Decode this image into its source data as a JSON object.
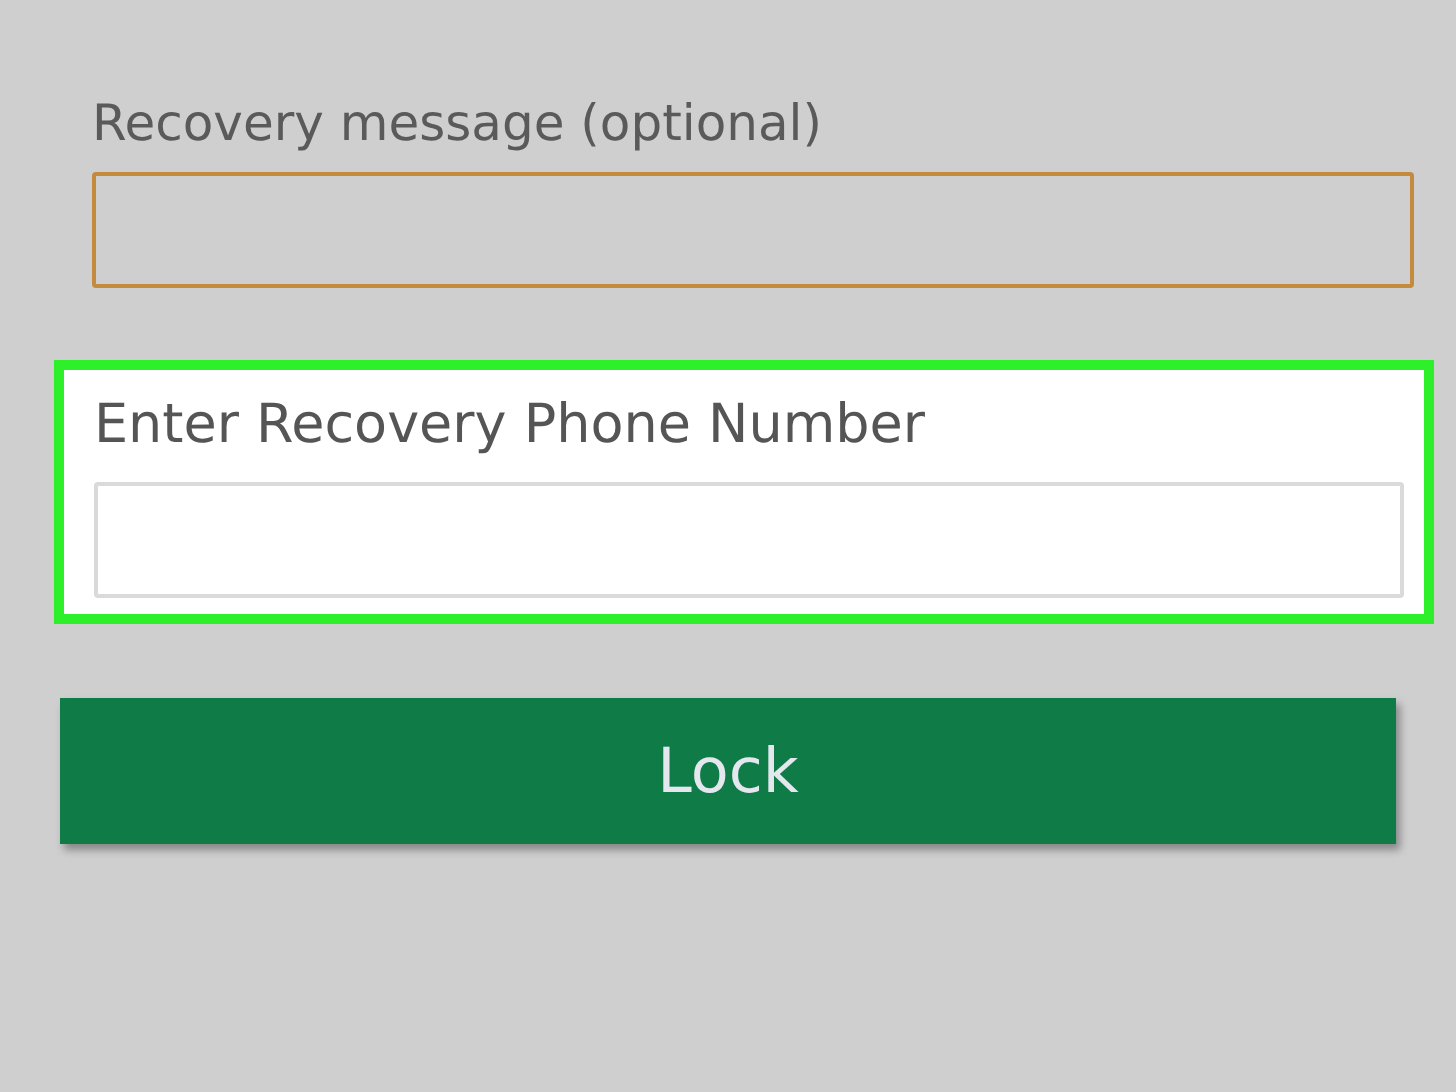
{
  "fields": [
    {
      "label": "Recovery message (optional)",
      "highlighted": false
    },
    {
      "label": "Enter Recovery Phone Number",
      "highlighted": true
    }
  ],
  "button": {
    "label": "Lock"
  }
}
